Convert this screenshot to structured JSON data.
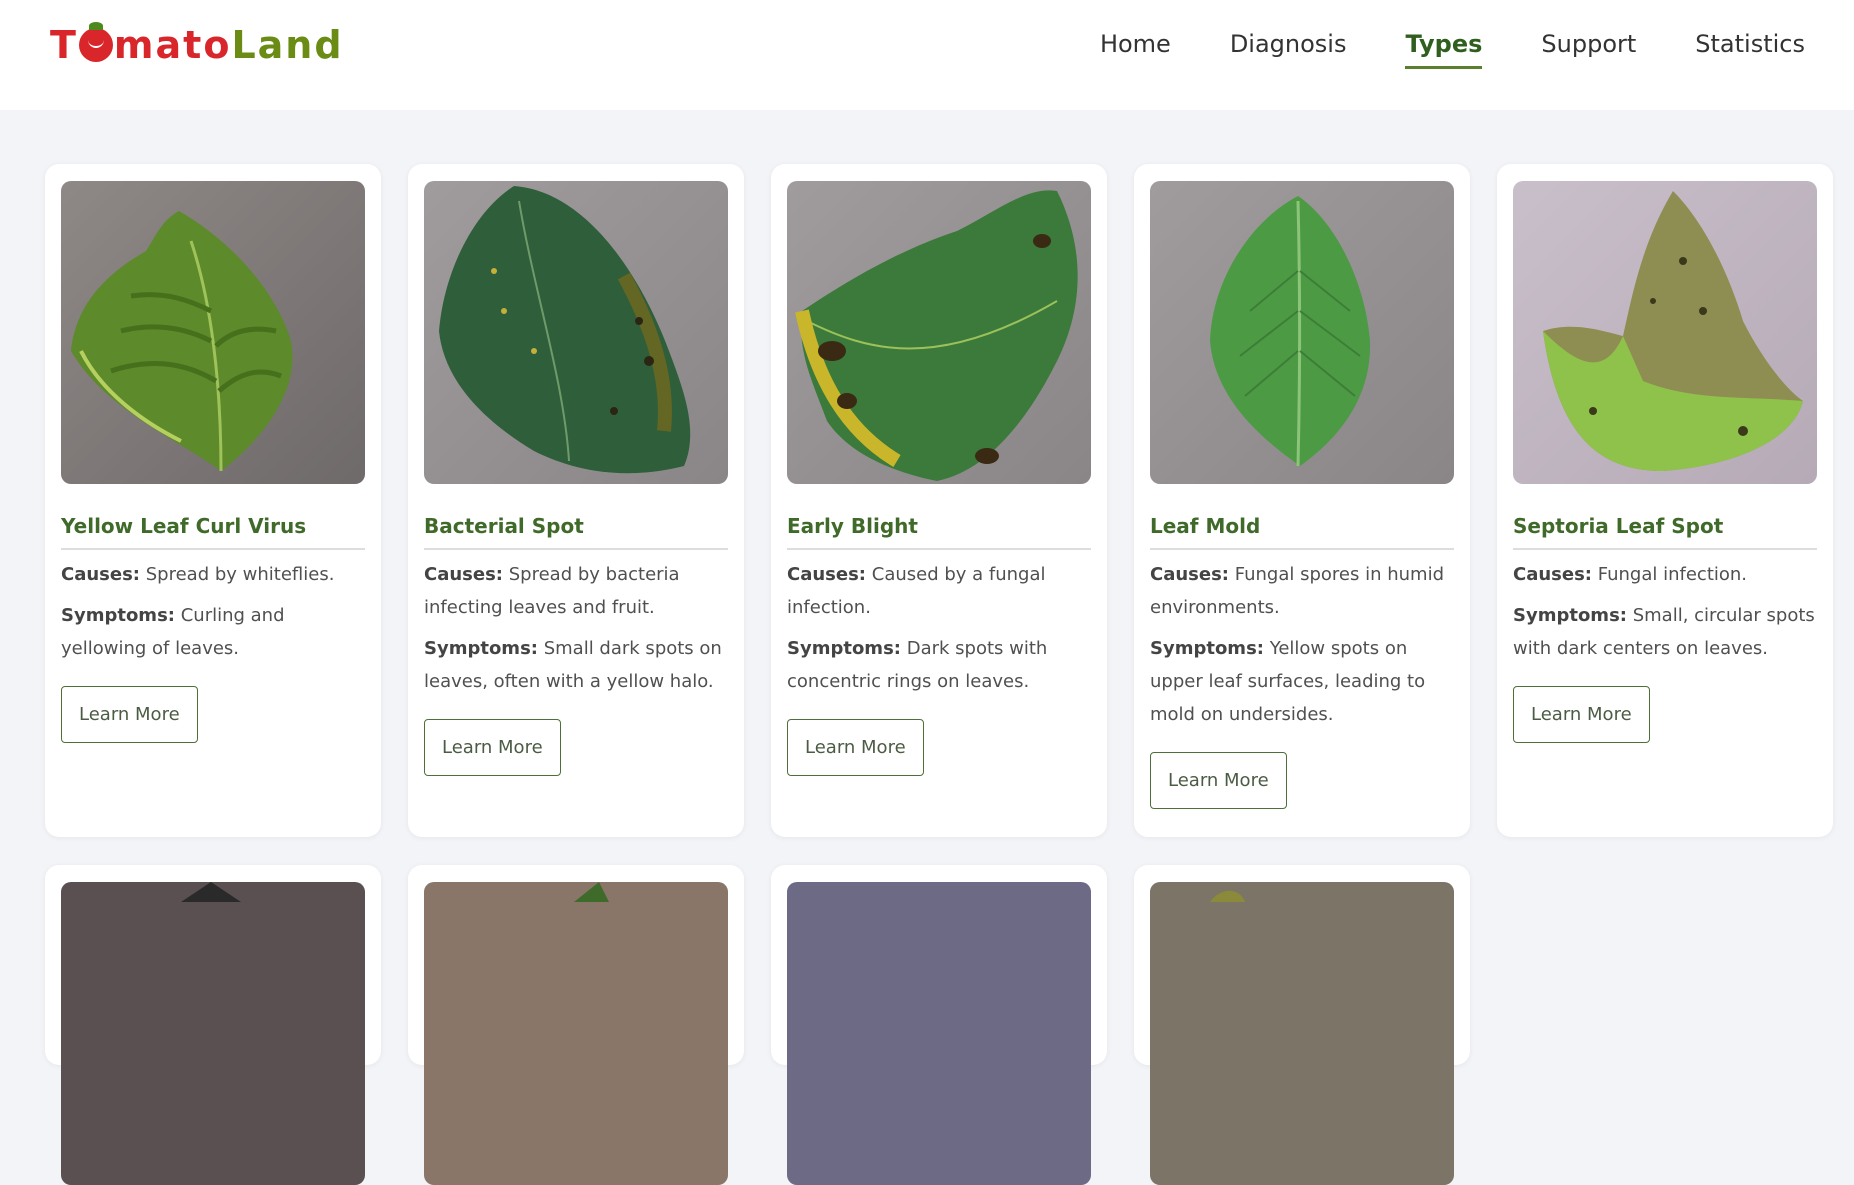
{
  "brand": {
    "logo_text": "TomatoLand",
    "colors": {
      "red": "#d9262b",
      "green": "#6a8c15"
    }
  },
  "nav": {
    "items": [
      {
        "label": "Home",
        "active": false
      },
      {
        "label": "Diagnosis",
        "active": false
      },
      {
        "label": "Types",
        "active": true
      },
      {
        "label": "Support",
        "active": false
      },
      {
        "label": "Statistics",
        "active": false
      }
    ]
  },
  "labels": {
    "causes": "Causes:",
    "symptoms": "Symptoms:",
    "learn_more": "Learn More"
  },
  "cards": [
    {
      "title": "Yellow Leaf Curl Virus",
      "causes": "Spread by whiteflies.",
      "symptoms": "Curling and yellowing of leaves.",
      "image": "curled-yellow-green-leaf"
    },
    {
      "title": "Bacterial Spot",
      "causes": "Spread by bacteria infecting leaves and fruit.",
      "symptoms": "Small dark spots on leaves, often with a yellow halo.",
      "image": "dark-green-leaf-with-spots"
    },
    {
      "title": "Early Blight",
      "causes": "Caused by a fungal infection.",
      "symptoms": "Dark spots with concentric rings on leaves.",
      "image": "leaf-with-dark-ring-spots"
    },
    {
      "title": "Leaf Mold",
      "causes": "Fungal spores in humid environments.",
      "symptoms": "Yellow spots on upper leaf surfaces, leading to mold on undersides.",
      "image": "green-leaf"
    },
    {
      "title": "Septoria Leaf Spot",
      "causes": "Fungal infection.",
      "symptoms": "Small, circular spots with dark centers on leaves.",
      "image": "spotted-decayed-leaf"
    }
  ],
  "second_row_images": [
    "dark-leaf-thumbnail",
    "brown-leaf-thumbnail",
    "purple-gray-leaf-thumbnail",
    "olive-leaf-thumbnail"
  ]
}
